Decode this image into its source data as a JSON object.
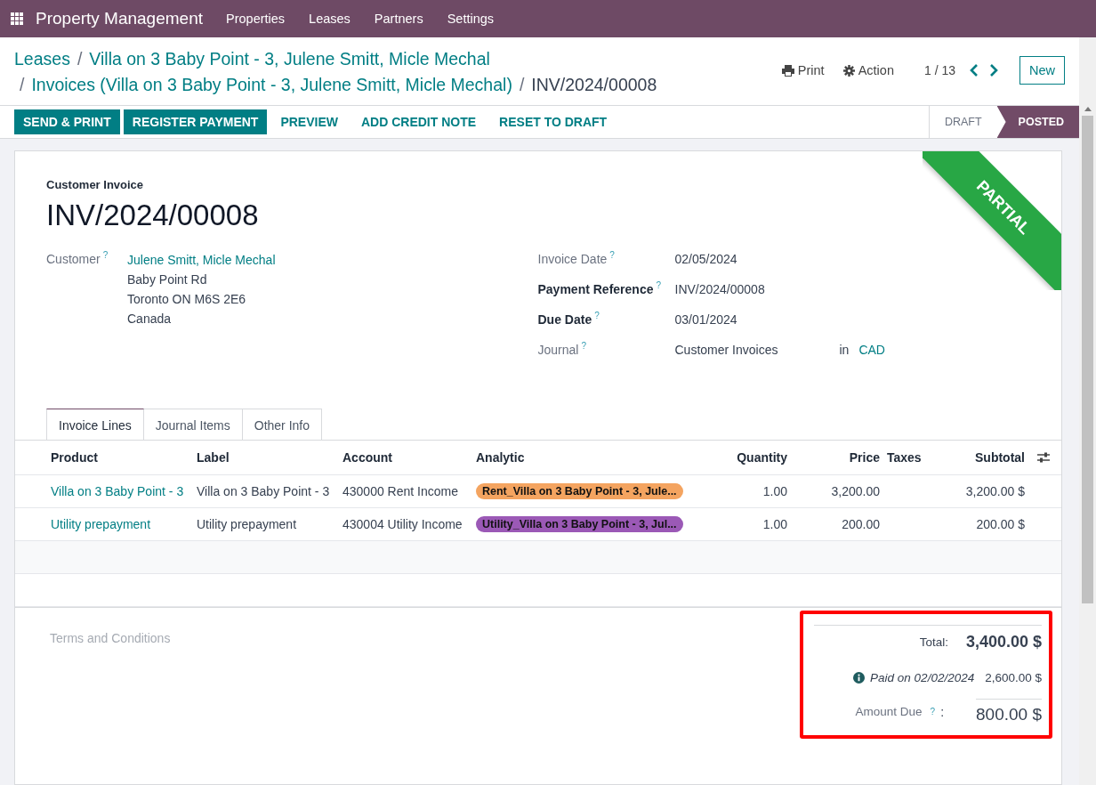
{
  "navbar": {
    "app_title": "Property Management",
    "menu": [
      "Properties",
      "Leases",
      "Partners",
      "Settings"
    ]
  },
  "breadcrumbs": [
    [
      {
        "label": "Leases",
        "current": false
      },
      {
        "sep": "/",
        "label": "Villa on 3 Baby Point - 3, Julene Smitt, Micle Mechal",
        "current": false
      }
    ],
    [
      {
        "sep": "/",
        "label": "Invoices (Villa on 3 Baby Point - 3, Julene Smitt, Micle Mechal)",
        "current": false
      },
      {
        "sep": "/",
        "label": "INV/2024/00008",
        "current": true
      }
    ]
  ],
  "control_panel": {
    "print": "Print",
    "action": "Action",
    "pager": "1 / 13",
    "new": "New"
  },
  "action_buttons": [
    {
      "label": "SEND & PRINT",
      "kind": "primary"
    },
    {
      "label": "REGISTER PAYMENT",
      "kind": "primary"
    },
    {
      "label": "PREVIEW",
      "kind": "link"
    },
    {
      "label": "ADD CREDIT NOTE",
      "kind": "link"
    },
    {
      "label": "RESET TO DRAFT",
      "kind": "link"
    }
  ],
  "status": [
    {
      "label": "DRAFT",
      "selected": false
    },
    {
      "label": "POSTED",
      "selected": true
    }
  ],
  "form": {
    "ribbon": "PARTIAL",
    "type": "Customer Invoice",
    "name": "INV/2024/00008",
    "customer": {
      "label": "Customer",
      "help": "?",
      "name": "Julene Smitt, Micle Mechal",
      "address": [
        "Baby Point Rd",
        "Toronto ON M6S 2E6",
        "Canada"
      ]
    },
    "fields": [
      {
        "label": "Invoice Date",
        "help": "?",
        "required": false,
        "value": "02/05/2024"
      },
      {
        "label": "Payment Reference",
        "help": "?",
        "required": true,
        "value": "INV/2024/00008"
      },
      {
        "label": "Due Date",
        "help": "?",
        "required": true,
        "value": "03/01/2024"
      },
      {
        "label": "Journal",
        "help": "?",
        "required": false,
        "value": "Customer Invoices",
        "joiner": "in",
        "currency": "CAD"
      }
    ]
  },
  "tabs": [
    {
      "label": "Invoice Lines",
      "selected": true
    },
    {
      "label": "Journal Items",
      "selected": false
    },
    {
      "label": "Other Info",
      "selected": false
    }
  ],
  "table": {
    "columns": [
      "Product",
      "Label",
      "Account",
      "Analytic",
      "Quantity",
      "Price",
      "Taxes",
      "Subtotal"
    ],
    "rows": [
      {
        "product": "Villa on 3 Baby Point - 3",
        "label": "Villa on 3 Baby Point - 3",
        "account": "430000 Rent Income",
        "analytic": {
          "text": "Rent_Villa on 3 Baby Point - 3, Jule...",
          "color": "#f4a460"
        },
        "quantity": "1.00",
        "price": "3,200.00",
        "subtotal": "3,200.00 $"
      },
      {
        "product": "Utility prepayment",
        "label": "Utility prepayment",
        "account": "430004 Utility Income",
        "analytic": {
          "text": "Utility_Villa on 3 Baby Point - 3, Jul...",
          "color": "#9b59b6"
        },
        "quantity": "1.00",
        "price": "200.00",
        "subtotal": "200.00 $"
      }
    ]
  },
  "terms_placeholder": "Terms and Conditions",
  "totals": {
    "highlighted": true,
    "total_label": "Total:",
    "total": "3,400.00 $",
    "payment_note": "Paid on 02/02/2024",
    "paid": "2,600.00 $",
    "due_label": "Amount Due",
    "due_help": "?",
    "due_suffix": ":",
    "due": "800.00 $"
  }
}
